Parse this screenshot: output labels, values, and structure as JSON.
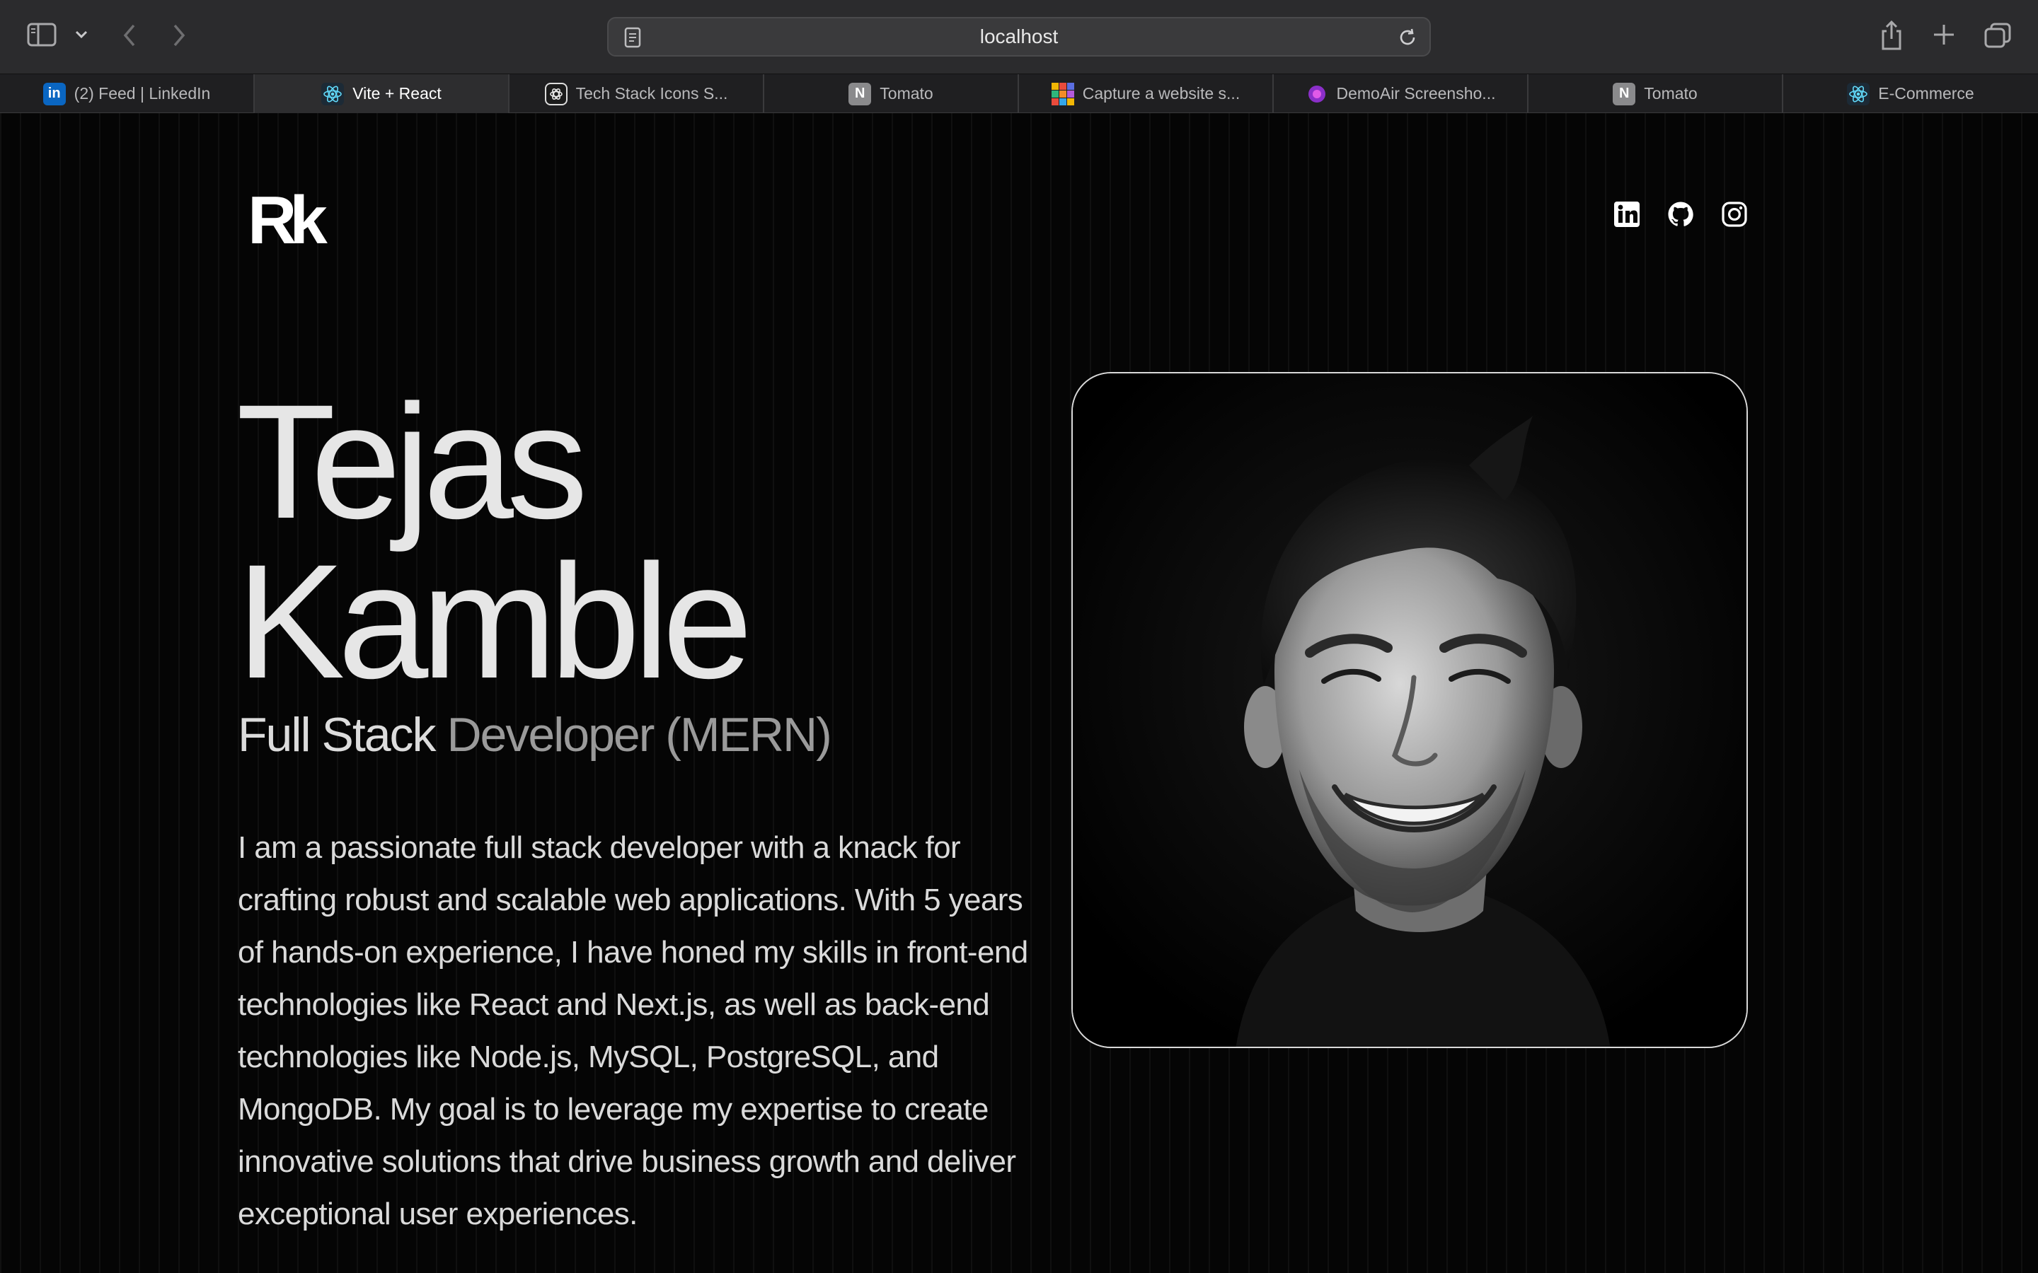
{
  "browser": {
    "url": "localhost",
    "tabs": [
      {
        "label": "(2) Feed | LinkedIn",
        "icon": "linkedin-icon",
        "active": false
      },
      {
        "label": "Vite + React",
        "icon": "react-icon",
        "active": true
      },
      {
        "label": "Tech Stack Icons S...",
        "icon": "openai-icon",
        "active": false
      },
      {
        "label": "Tomato",
        "icon": "notion-icon",
        "active": false
      },
      {
        "label": "Capture a website s...",
        "icon": "color-grid-icon",
        "active": false
      },
      {
        "label": "DemoAir Screensho...",
        "icon": "demoair-icon",
        "active": false
      },
      {
        "label": "Tomato",
        "icon": "notion-icon",
        "active": false
      },
      {
        "label": "E-Commerce",
        "icon": "react-icon",
        "active": false
      }
    ],
    "favicon_letters": {
      "linkedin": "in",
      "notion": "N"
    }
  },
  "site": {
    "logo": "Rk",
    "socials": [
      "linkedin-icon",
      "github-icon",
      "instagram-icon"
    ],
    "name_first": "Tejas",
    "name_last": "Kamble",
    "role_primary": "Full Stack",
    "role_secondary": "Developer (MERN)",
    "bio": "I am a passionate full stack developer with a knack for crafting robust and scalable web applications. With 5 years of hands-on experience, I have honed my skills in front-end technologies like React and Next.js, as well as back-end technologies like Node.js, MySQL, PostgreSQL, and MongoDB. My goal is to leverage my expertise to create innovative solutions that drive business growth and deliver exceptional user experiences.",
    "photo": "portrait-photo"
  },
  "colors": {
    "background": "#050505",
    "text": "#e6e6e6",
    "muted": "#9a9a9a",
    "chrome": "#2b2b2d"
  }
}
